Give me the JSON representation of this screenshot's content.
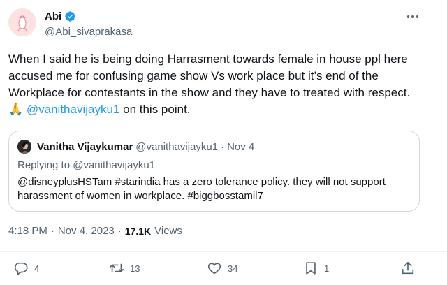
{
  "author": {
    "name": "Abi",
    "handle": "@Abi_sivaprakasa"
  },
  "tweet": {
    "text_before": "When I said he is being doing Harrasment towards female in house ppl here accused me for confusing game show Vs work place but it’s end of the Workplace for contestants in the show and they have to treated with respect. 🙏 ",
    "mention": "@vanithavijayku1",
    "text_after": " on this point."
  },
  "quote": {
    "name": "Vanitha Vijaykumar",
    "handle": "@vanithavijayku1",
    "separator": "·",
    "date": "Nov 4",
    "reply_label": "Replying to @vanithavijayku1",
    "text": "@disneyplusHSTam #starindia has a zero tolerance policy. they will not support harassment of women in workplace. #biggbosstamil7"
  },
  "meta": {
    "time": "4:18 PM",
    "separator": "·",
    "date": "Nov 4, 2023",
    "separator2": "·",
    "views": "17.1K",
    "views_label": "Views"
  },
  "actions": {
    "replies": "4",
    "retweets": "13",
    "likes": "34",
    "bookmarks": "1"
  },
  "colors": {
    "accent": "#1d9bf0",
    "secondary_text": "#536471",
    "primary_text": "#0f1419",
    "border": "#cfd9de"
  },
  "icons": [
    "verified-badge-icon",
    "more-icon",
    "reply-icon",
    "retweet-icon",
    "like-icon",
    "bookmark-icon",
    "share-icon"
  ]
}
